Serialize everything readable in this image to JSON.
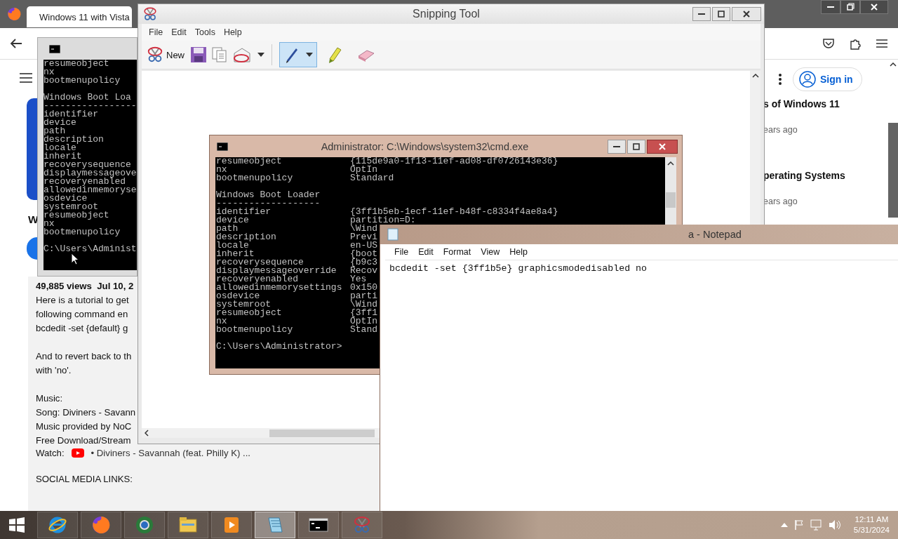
{
  "browser": {
    "tab_title": "Windows 11 with Vista",
    "video_title": "W",
    "sign_in": "Sign in",
    "stats": "49,885 views  Jul 10, 2",
    "description": [
      [
        "Here is a tutorial to get",
        "following command en",
        "bcdedit -set {default} g"
      ],
      [
        "And to revert back to th",
        "with 'no'."
      ],
      [
        "Music:",
        "Song: Diviners - Savann",
        "Music provided by NoC",
        "Free Download/Stream"
      ]
    ],
    "watch_label": "Watch:",
    "watch_link": "• Diviners - Savannah (feat. Philly K) ...",
    "social_heading": "SOCIAL MEDIA LINKS:",
    "sidebar": [
      {
        "title": "s of Windows 11",
        "age": "ears ago"
      },
      {
        "title": "perating Systems",
        "age": "ears ago"
      }
    ]
  },
  "back_console": {
    "blocks": [
      [
        "resumeobject",
        "nx",
        "bootmenupolicy"
      ],
      [
        "Windows Boot Loa",
        "-----------------",
        "identifier",
        "device",
        "path",
        "description",
        "locale",
        "inherit",
        "recoverysequence",
        "displaymessageove",
        "recoveryenabled",
        "allowedinmemoryse",
        "osdevice",
        "systemroot",
        "resumeobject",
        "nx",
        "bootmenupolicy"
      ],
      [
        "C:\\Users\\Administ"
      ]
    ]
  },
  "snipping_tool": {
    "title": "Snipping Tool",
    "menu": [
      "File",
      "Edit",
      "Tools",
      "Help"
    ],
    "new_label": "New",
    "tools": [
      {
        "kind": "pen",
        "selected": true
      },
      {
        "kind": "highlighter",
        "selected": false
      },
      {
        "kind": "eraser",
        "selected": false
      }
    ]
  },
  "console": {
    "title": "Administrator: C:\\Windows\\system32\\cmd.exe",
    "blocks": [
      [
        {
          "name": "resumeobject",
          "value": "{115de9a0-1f13-11ef-ad08-df0726143e36}"
        },
        {
          "name": "nx",
          "value": "OptIn"
        },
        {
          "name": "bootmenupolicy",
          "value": "Standard"
        }
      ],
      [
        {
          "text": "Windows Boot Loader"
        },
        {
          "text": "-------------------"
        },
        {
          "name": "identifier",
          "value": "{3ff1b5eb-1ecf-11ef-b48f-c8334f4ae8a4}"
        },
        {
          "name": "device",
          "value": "partition=D:"
        },
        {
          "name": "path",
          "value": "\\Wind"
        },
        {
          "name": "description",
          "value": "Previ"
        },
        {
          "name": "locale",
          "value": "en-US"
        },
        {
          "name": "inherit",
          "value": "{boot"
        },
        {
          "name": "recoverysequence",
          "value": "{b9c3"
        },
        {
          "name": "displaymessageoverride",
          "value": "Recov"
        },
        {
          "name": "recoveryenabled",
          "value": "Yes"
        },
        {
          "name": "allowedinmemorysettings",
          "value": "0x150"
        },
        {
          "name": "osdevice",
          "value": "parti"
        },
        {
          "name": "systemroot",
          "value": "\\Wind"
        },
        {
          "name": "resumeobject",
          "value": "{3ff1"
        },
        {
          "name": "nx",
          "value": "OptIn"
        },
        {
          "name": "bootmenupolicy",
          "value": "Stand"
        }
      ],
      [
        {
          "text": "C:\\Users\\Administrator>"
        }
      ]
    ]
  },
  "notepad": {
    "title": "a - Notepad",
    "menu": [
      "File",
      "Edit",
      "Format",
      "View",
      "Help"
    ],
    "text": "bcdedit -set {3ff1b5e} graphicsmodedisabled no"
  },
  "taskbar": {
    "apps": [
      {
        "kind": "ie",
        "selected": false
      },
      {
        "kind": "firefox",
        "selected": false
      },
      {
        "kind": "chrome",
        "selected": false
      },
      {
        "kind": "explorer",
        "selected": false
      },
      {
        "kind": "media",
        "selected": false
      },
      {
        "kind": "notepad",
        "selected": true
      },
      {
        "kind": "cmd",
        "selected": false
      },
      {
        "kind": "snipping",
        "selected": false
      }
    ],
    "time": "12:11 AM",
    "date": "5/31/2024"
  }
}
